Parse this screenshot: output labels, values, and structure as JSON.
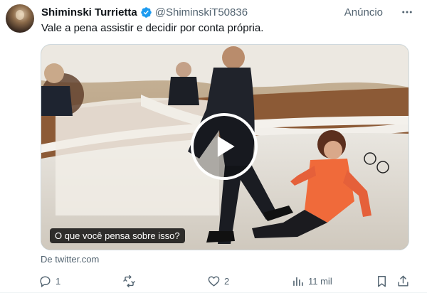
{
  "tweet": {
    "author": {
      "display_name": "Shiminski Turrietta",
      "handle": "@ShiminskiT50836",
      "verified": true
    },
    "ad_label": "Anúncio",
    "more_icon": "more-horizontal-icon",
    "text": "Vale a pena assistir e decidir por conta própria.",
    "media": {
      "type": "video",
      "caption": "O que você pensa sobre isso?",
      "play_icon": "play-icon"
    },
    "source": "De twitter.com",
    "actions": {
      "reply": {
        "icon": "reply-icon",
        "count": "1"
      },
      "retweet": {
        "icon": "retweet-icon",
        "count": ""
      },
      "like": {
        "icon": "heart-icon",
        "count": "2"
      },
      "views": {
        "icon": "views-icon",
        "count": "11 mil"
      },
      "bookmark": {
        "icon": "bookmark-icon"
      },
      "share": {
        "icon": "share-icon"
      }
    },
    "colors": {
      "text_primary": "#0f1419",
      "text_secondary": "#536471",
      "verified_blue": "#1d9bf0",
      "border": "#cfd9de"
    }
  }
}
